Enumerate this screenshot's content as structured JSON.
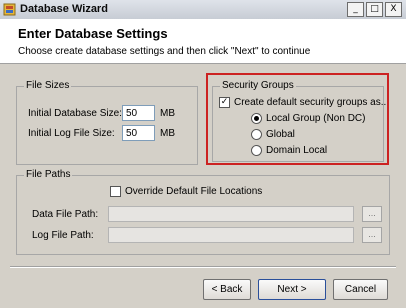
{
  "window": {
    "title": "Database Wizard",
    "controls": [
      "_",
      "□",
      "X"
    ]
  },
  "header": {
    "title": "Enter Database Settings",
    "subtitle": "Choose create database settings and then click \"Next\" to continue"
  },
  "file_sizes": {
    "group_label": "File Sizes",
    "db_size_label": "Initial Database Size:",
    "db_size_value": "50",
    "db_size_unit": "MB",
    "log_size_label": "Initial Log File Size:",
    "log_size_value": "50",
    "log_size_unit": "MB"
  },
  "security_groups": {
    "group_label": "Security Groups",
    "create_default_label": "Create default security groups as...",
    "create_default_checked": true,
    "options": [
      {
        "label": "Local Group (Non DC)",
        "selected": true
      },
      {
        "label": "Global",
        "selected": false
      },
      {
        "label": "Domain Local",
        "selected": false
      }
    ]
  },
  "file_paths": {
    "group_label": "File Paths",
    "override_label": "Override Default File Locations",
    "override_checked": false,
    "data_path_label": "Data File Path:",
    "data_path_value": "",
    "log_path_label": "Log File Path:",
    "log_path_value": "",
    "browse_label": "..."
  },
  "footer": {
    "back_label": "< Back",
    "next_label": "Next >",
    "cancel_label": "Cancel"
  },
  "colors": {
    "highlight": "#cc2222",
    "dialog_bg": "#d4d0c8",
    "header_bg": "#ffffff"
  }
}
